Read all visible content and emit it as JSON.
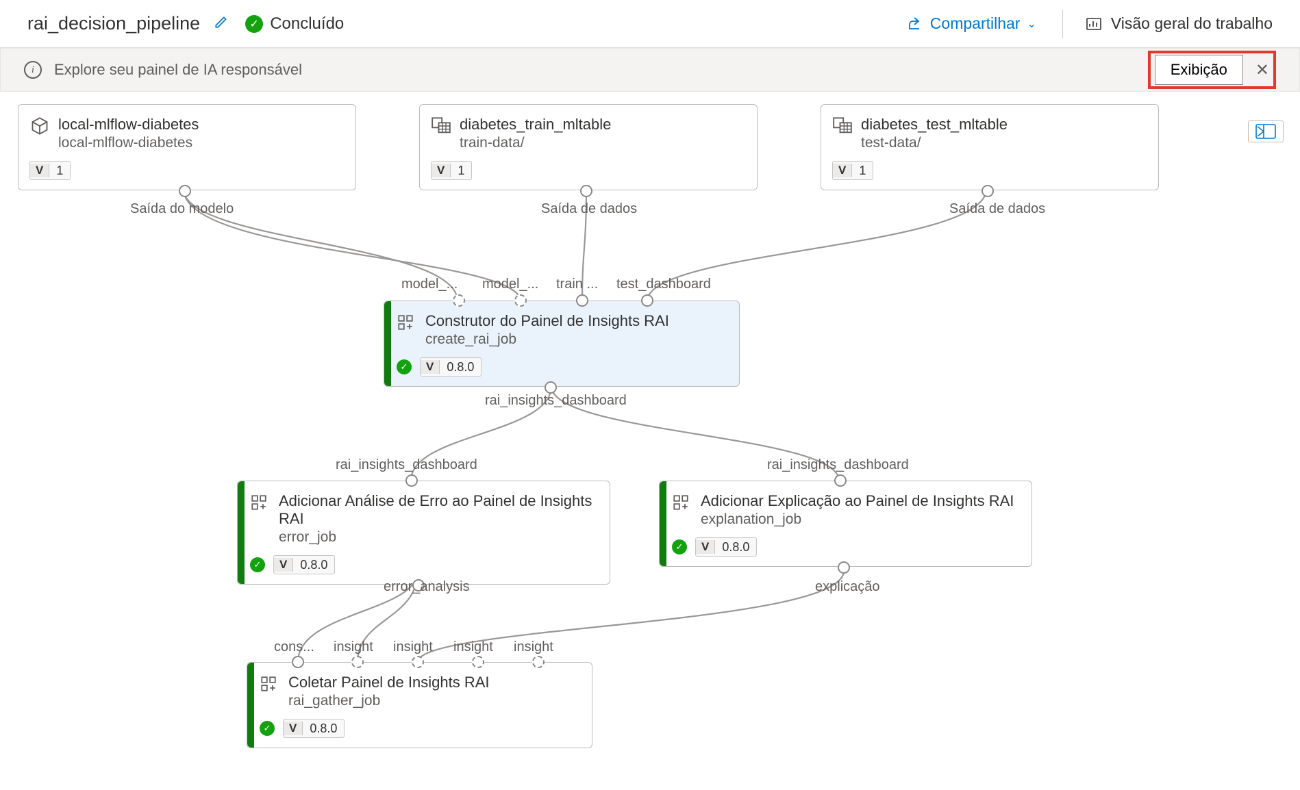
{
  "header": {
    "title": "rai_decision_pipeline",
    "status_label": "Concluído",
    "share_label": "Compartilhar",
    "overview_label": "Visão geral do trabalho"
  },
  "banner": {
    "text": "Explore seu painel de IA responsável",
    "exhibit_label": "Exibição"
  },
  "nodes": {
    "mlflow": {
      "title": "local-mlflow-diabetes",
      "subtitle": "local-mlflow-diabetes",
      "version": "1",
      "out_label": "Saída do modelo"
    },
    "train": {
      "title": "diabetes_train_mltable",
      "subtitle": "train-data/",
      "version": "1",
      "out_label": "Saída de dados"
    },
    "test": {
      "title": "diabetes_test_mltable",
      "subtitle": "test-data/",
      "version": "1",
      "out_label": "Saída de dados"
    },
    "builder": {
      "title": "Construtor do Painel de Insights RAI",
      "subtitle": "create_rai_job",
      "version": "0.8.0",
      "in_labels": [
        "model_...",
        "model_...",
        "train ...",
        "test_dashboard"
      ],
      "out_label": "rai_insights_dashboard"
    },
    "error": {
      "title": "Adicionar Análise de Erro ao Painel de Insights RAI",
      "subtitle": "error_job",
      "version": "0.8.0",
      "in_label": "rai_insights_dashboard",
      "out_label": "error_analysis"
    },
    "explain": {
      "title": "Adicionar Explicação ao Painel de Insights RAI",
      "subtitle": "explanation_job",
      "version": "0.8.0",
      "in_label": "rai_insights_dashboard",
      "out_label": "explicação"
    },
    "gather": {
      "title": "Coletar Painel de Insights RAI",
      "subtitle": "rai_gather_job",
      "version": "0.8.0",
      "in_labels": [
        "cons...",
        "insight",
        "insight",
        "insight",
        "insight"
      ]
    }
  },
  "version_prefix": "V"
}
